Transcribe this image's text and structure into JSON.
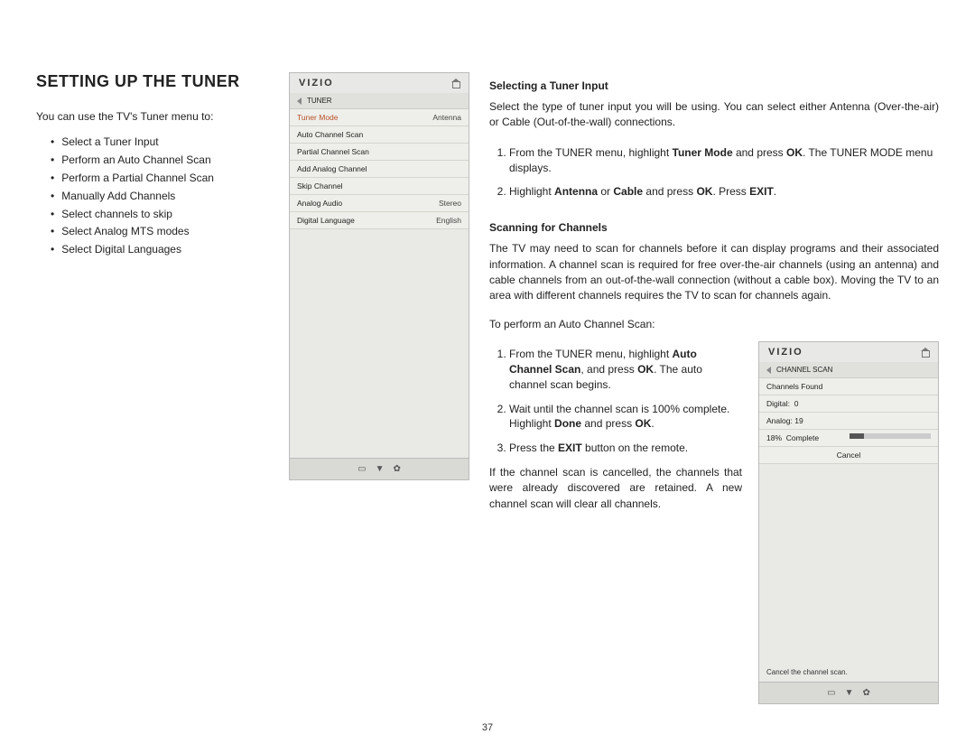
{
  "page_number": "37",
  "left": {
    "heading": "SETTING UP THE TUNER",
    "intro": "You can use the TV's Tuner menu to:",
    "bullets": [
      "Select a Tuner Input",
      "Perform an Auto Channel Scan",
      "Perform a Partial Channel Scan",
      "Manually Add Channels",
      "Select channels to skip",
      "Select Analog MTS modes",
      "Select Digital Languages"
    ]
  },
  "tuner_panel": {
    "brand": "VIZIO",
    "crumb": "TUNER",
    "rows": [
      {
        "label": "Tuner Mode",
        "value": "Antenna",
        "hi": true
      },
      {
        "label": "Auto Channel Scan",
        "value": ""
      },
      {
        "label": "Partial Channel Scan",
        "value": ""
      },
      {
        "label": "Add Analog Channel",
        "value": ""
      },
      {
        "label": "Skip Channel",
        "value": ""
      },
      {
        "label": "Analog Audio",
        "value": "Stereo"
      },
      {
        "label": "Digital Language",
        "value": "English"
      }
    ]
  },
  "right": {
    "sec1_head": "Selecting a Tuner Input",
    "sec1_para": "Select the type of tuner input you will be using. You can select either Antenna (Over-the-air) or Cable (Out-of-the-wall) connections.",
    "sec1_step1_a": "From the TUNER menu, highlight ",
    "sec1_step1_b": "Tuner Mode",
    "sec1_step1_c": " and press ",
    "sec1_step1_d": "OK",
    "sec1_step1_e": ". The TUNER MODE menu displays.",
    "sec1_step2_a": "Highlight ",
    "sec1_step2_b": "Antenna",
    "sec1_step2_c": " or ",
    "sec1_step2_d": "Cable",
    "sec1_step2_e": " and press ",
    "sec1_step2_f": "OK",
    "sec1_step2_g": ". Press ",
    "sec1_step2_h": "EXIT",
    "sec1_step2_i": ".",
    "sec2_head": "Scanning for Channels",
    "sec2_para": "The TV may need to scan for channels before it can display programs and their associated information. A channel scan is required for free over-the-air channels (using an antenna) and cable channels from an out-of-the-wall connection (without a cable box). Moving the TV to an area with different channels requires the TV to scan for channels again.",
    "sec2_lead": "To perform an Auto Channel Scan:",
    "sec2_s1_a": "From the TUNER menu, highlight ",
    "sec2_s1_b": "Auto Channel Scan",
    "sec2_s1_c": ", and press ",
    "sec2_s1_d": "OK",
    "sec2_s1_e": ". The auto channel scan begins.",
    "sec2_s2_a": "Wait until the channel scan is 100% complete. Highlight ",
    "sec2_s2_b": "Done",
    "sec2_s2_c": " and press ",
    "sec2_s2_d": "OK",
    "sec2_s2_e": ".",
    "sec2_s3_a": "Press the ",
    "sec2_s3_b": "EXIT",
    "sec2_s3_c": " button on the remote.",
    "sec2_note": "If the channel scan is cancelled, the channels that were already discovered are retained. A new channel scan will clear all channels."
  },
  "scan_panel": {
    "brand": "VIZIO",
    "crumb": "CHANNEL SCAN",
    "found": "Channels Found",
    "digital_label": "Digital:",
    "digital_val": "0",
    "analog_label": "Analog:",
    "analog_val": "19",
    "pct": "18%",
    "complete": "Complete",
    "cancel": "Cancel",
    "hint": "Cancel the channel scan."
  }
}
